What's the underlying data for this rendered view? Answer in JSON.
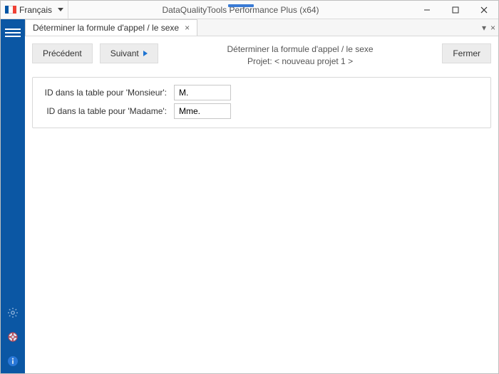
{
  "titlebar": {
    "language_label": "Français",
    "app_title": "DataQualityTools Performance Plus (x64)"
  },
  "tab": {
    "label": "Déterminer la formule d'appel / le sexe"
  },
  "toolbar": {
    "prev_label": "Précédent",
    "next_label": "Suivant",
    "close_label": "Fermer",
    "heading": "Déterminer la formule d'appel / le sexe",
    "project_line": "Projet: < nouveau projet 1 >"
  },
  "form": {
    "monsieur_label": "ID dans la table pour 'Monsieur':",
    "monsieur_value": "M.",
    "madame_label": "ID dans la table pour 'Madame':",
    "madame_value": "Mme."
  }
}
